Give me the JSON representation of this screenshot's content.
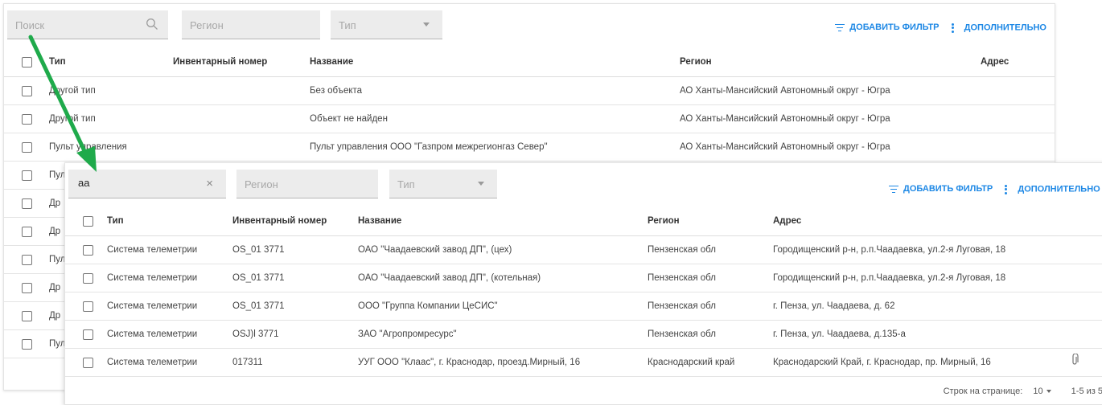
{
  "bg": {
    "search_placeholder": "Поиск",
    "region_placeholder": "Регион",
    "type_placeholder": "Тип",
    "add_filter": "ДОБАВИТЬ ФИЛЬТР",
    "more": "ДОПОЛНИТЕЛЬНО",
    "columns": [
      "Тип",
      "Инвентарный номер",
      "Название",
      "Регион",
      "Адрес"
    ],
    "rows": [
      {
        "type": "Другой тип",
        "inv": "",
        "name": "Без объекта",
        "region": "АО Ханты-Мансийский Автономный округ - Югра",
        "address": ""
      },
      {
        "type": "Другой тип",
        "inv": "",
        "name": "Объект не найден",
        "region": "АО Ханты-Мансийский Автономный округ - Югра",
        "address": ""
      },
      {
        "type": "Пульт управления",
        "inv": "",
        "name": "Пульт управления ООО \"Газпром межрегионгаз Север\"",
        "region": "АО Ханты-Мансийский Автономный округ - Югра",
        "address": ""
      },
      {
        "type": "Пул",
        "inv": "",
        "name": "",
        "region": "",
        "address": ""
      },
      {
        "type": "Др",
        "inv": "",
        "name": "",
        "region": "",
        "address": ""
      },
      {
        "type": "Др",
        "inv": "",
        "name": "",
        "region": "",
        "address": ""
      },
      {
        "type": "Пул",
        "inv": "",
        "name": "",
        "region": "",
        "address": ""
      },
      {
        "type": "Др",
        "inv": "",
        "name": "",
        "region": "",
        "address": ""
      },
      {
        "type": "Др",
        "inv": "",
        "name": "",
        "region": "",
        "address": ""
      },
      {
        "type": "Пул",
        "inv": "",
        "name": "",
        "region": "",
        "address": ""
      }
    ]
  },
  "fg": {
    "search_value": "аа",
    "clear_symbol": "×",
    "region_placeholder": "Регион",
    "type_placeholder": "Тип",
    "add_filter": "ДОБАВИТЬ ФИЛЬТР",
    "more": "ДОПОЛНИТЕЛЬНО",
    "columns": [
      "Тип",
      "Инвентарный номер",
      "Название",
      "Регион",
      "Адрес"
    ],
    "rows": [
      {
        "type": "Система телеметрии",
        "inv": "OS_01 3771",
        "name": "ОАО \"Чаадаевский завод ДП\", (цех)",
        "region": "Пензенская обл",
        "address": "Городищенский р-н, р.п.Чаадаевка, ул.2-я Луговая, 18",
        "attachment": false
      },
      {
        "type": "Система телеметрии",
        "inv": "OS_01 3771",
        "name": "ОАО \"Чаадаевский завод ДП\", (котельная)",
        "region": "Пензенская обл",
        "address": "Городищенский р-н, р.п.Чаадаевка, ул.2-я Луговая, 18",
        "attachment": false
      },
      {
        "type": "Система телеметрии",
        "inv": "OS_01 3771",
        "name": "ООО \"Группа Компании ЦеСИС\"",
        "region": "Пензенская обл",
        "address": "г. Пенза, ул. Чаадаева, д. 62",
        "attachment": false
      },
      {
        "type": "Система телеметрии",
        "inv": "OSJ)l 3771",
        "name": "ЗАО \"Агропромресурс\"",
        "region": "Пензенская обл",
        "address": "г. Пенза, ул. Чаадаева, д.135-а",
        "attachment": false
      },
      {
        "type": "Система телеметрии",
        "inv": "017311",
        "name": "УУГ ООО \"Клаас\", г. Краснодар, проезд.Мирный, 16",
        "region": "Краснодарский край",
        "address": "Краснодарский Край, г. Краснодар, пр. Мирный, 16",
        "attachment": true
      }
    ],
    "rows_per_page_label": "Строк на странице:",
    "rows_per_page": "10",
    "range": "1-5 из 5"
  },
  "colors": {
    "accent": "#1e88e5",
    "arrow": "#1faa4b"
  },
  "icons": [
    "search-icon",
    "clear-icon",
    "filter-icon",
    "more-vert-icon",
    "attachment-icon",
    "chevron-down-icon"
  ]
}
